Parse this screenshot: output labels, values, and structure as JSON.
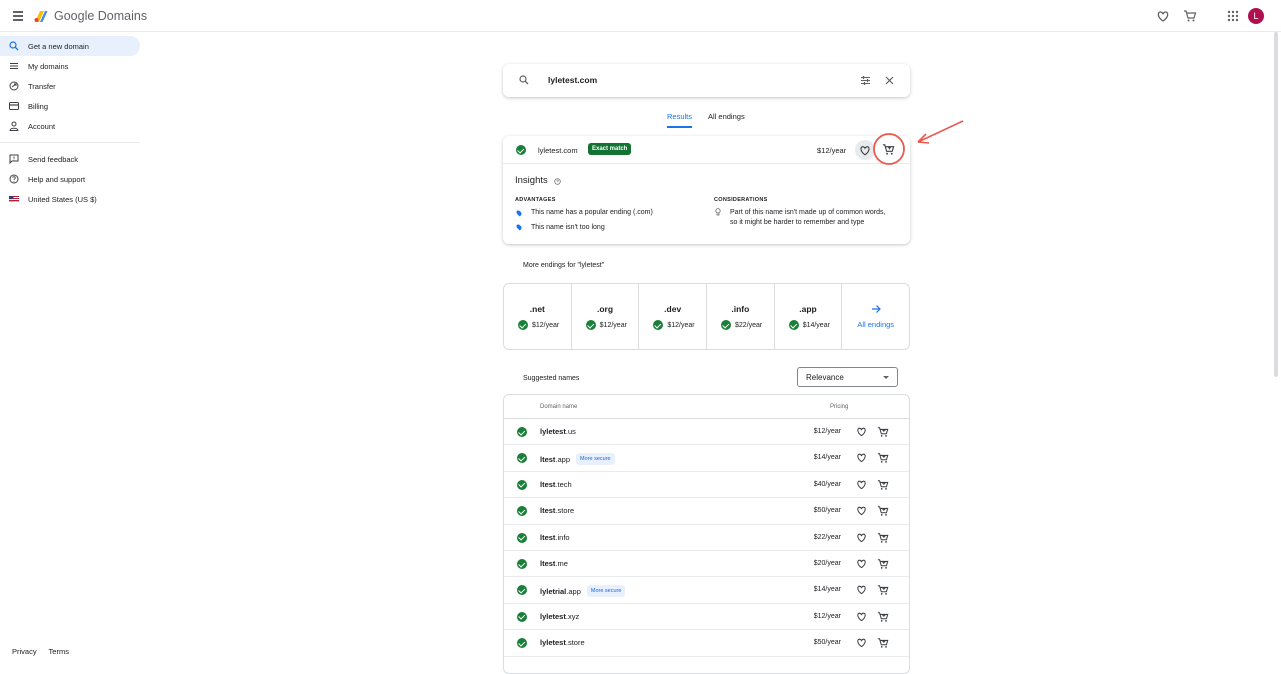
{
  "brand": {
    "name": "Google Domains"
  },
  "user": {
    "avatar_letter": "L",
    "avatar_color": "#b0104f"
  },
  "sidebar": {
    "items": [
      {
        "label": "Get a new domain",
        "icon": "search-icon",
        "active": true
      },
      {
        "label": "My domains",
        "icon": "list-icon"
      },
      {
        "label": "Transfer",
        "icon": "transfer-icon"
      },
      {
        "label": "Billing",
        "icon": "credit-card-icon"
      },
      {
        "label": "Account",
        "icon": "account-icon"
      }
    ],
    "secondary": [
      {
        "label": "Send feedback",
        "icon": "feedback-icon"
      },
      {
        "label": "Help and support",
        "icon": "help-icon"
      },
      {
        "label": "United States (US $)",
        "icon": "us-flag-icon"
      }
    ],
    "footer": {
      "privacy": "Privacy",
      "terms": "Terms"
    }
  },
  "search": {
    "value": "lyletest.com"
  },
  "tabs": {
    "results": "Results",
    "all_endings": "All endings"
  },
  "exact": {
    "domain": "lyletest.com",
    "badge": "Exact match",
    "price": "$12/year",
    "insights_title": "Insights",
    "advantages_title": "ADVANTAGES",
    "advantages": [
      "This name has a popular ending (.com)",
      "This name isn't too long"
    ],
    "considerations_title": "CONSIDERATIONS",
    "consideration_line1": "Part of this name isn't made up of common words,",
    "consideration_line2": "so it might be harder to remember and type"
  },
  "more_endings": {
    "title": "More endings for \"lyletest\"",
    "items": [
      {
        "tld": ".net",
        "price": "$12/year"
      },
      {
        "tld": ".org",
        "price": "$12/year"
      },
      {
        "tld": ".dev",
        "price": "$12/year"
      },
      {
        "tld": ".info",
        "price": "$22/year"
      },
      {
        "tld": ".app",
        "price": "$14/year"
      }
    ],
    "all_label": "All endings"
  },
  "suggested": {
    "title": "Suggested names",
    "sort": "Relevance",
    "col_domain": "Domain name",
    "col_pricing": "Pricing",
    "rows": [
      {
        "bold": "lyletest",
        "ext": ".us",
        "badge": "",
        "price": "$12/year"
      },
      {
        "bold": "ltest",
        "ext": ".app",
        "badge": "More secure",
        "price": "$14/year"
      },
      {
        "bold": "ltest",
        "ext": ".tech",
        "badge": "",
        "price": "$40/year"
      },
      {
        "bold": "ltest",
        "ext": ".store",
        "badge": "",
        "price": "$50/year"
      },
      {
        "bold": "ltest",
        "ext": ".info",
        "badge": "",
        "price": "$22/year"
      },
      {
        "bold": "ltest",
        "ext": ".me",
        "badge": "",
        "price": "$20/year"
      },
      {
        "bold": "lyletrial",
        "ext": ".app",
        "badge": "More secure",
        "price": "$14/year"
      },
      {
        "bold": "lyletest",
        "ext": ".xyz",
        "badge": "",
        "price": "$12/year"
      },
      {
        "bold": "lyletest",
        "ext": ".store",
        "badge": "",
        "price": "$50/year"
      }
    ]
  },
  "colors": {
    "accent": "#1a73e8",
    "available": "#188038",
    "annotation": "#e8594e"
  }
}
